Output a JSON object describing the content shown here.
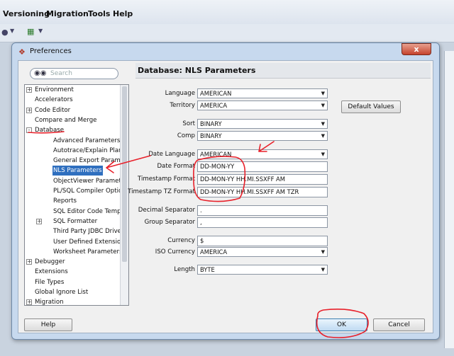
{
  "menubar": {
    "items": [
      "Versioning",
      "Migration",
      "Tools",
      "Help"
    ]
  },
  "dialog": {
    "title": "Preferences",
    "close_glyph": "x",
    "search_placeholder": "Search",
    "panel_title": "Database: NLS Parameters",
    "tree": [
      {
        "label": "Environment",
        "level": 0,
        "expander": "+",
        "selected": false
      },
      {
        "label": "Accelerators",
        "level": 0,
        "expander": "",
        "selected": false
      },
      {
        "label": "Code Editor",
        "level": 0,
        "expander": "+",
        "selected": false
      },
      {
        "label": "Compare and Merge",
        "level": 0,
        "expander": "",
        "selected": false
      },
      {
        "label": "Database",
        "level": 0,
        "expander": "-",
        "selected": false
      },
      {
        "label": "Advanced Parameters",
        "level": 1,
        "expander": "",
        "selected": false
      },
      {
        "label": "Autotrace/Explain Plan",
        "level": 1,
        "expander": "",
        "selected": false
      },
      {
        "label": "General Export Parame",
        "level": 1,
        "expander": "",
        "selected": false
      },
      {
        "label": "NLS Parameters",
        "level": 1,
        "expander": "",
        "selected": true
      },
      {
        "label": "ObjectViewer Paramete",
        "level": 1,
        "expander": "",
        "selected": false
      },
      {
        "label": "PL/SQL Compiler Option",
        "level": 1,
        "expander": "",
        "selected": false
      },
      {
        "label": "Reports",
        "level": 1,
        "expander": "",
        "selected": false
      },
      {
        "label": "SQL Editor Code Templ",
        "level": 1,
        "expander": "",
        "selected": false
      },
      {
        "label": "SQL Formatter",
        "level": 1,
        "expander": "+",
        "selected": false
      },
      {
        "label": "Third Party JDBC Drive",
        "level": 1,
        "expander": "",
        "selected": false
      },
      {
        "label": "User Defined Extension",
        "level": 1,
        "expander": "",
        "selected": false
      },
      {
        "label": "Worksheet Parameters",
        "level": 1,
        "expander": "",
        "selected": false
      },
      {
        "label": "Debugger",
        "level": 0,
        "expander": "+",
        "selected": false
      },
      {
        "label": "Extensions",
        "level": 0,
        "expander": "",
        "selected": false
      },
      {
        "label": "File Types",
        "level": 0,
        "expander": "",
        "selected": false
      },
      {
        "label": "Global Ignore List",
        "level": 0,
        "expander": "",
        "selected": false
      },
      {
        "label": "Migration",
        "level": 0,
        "expander": "+",
        "selected": false
      }
    ],
    "fields": {
      "language": {
        "label": "Language",
        "value": "AMERICAN"
      },
      "territory": {
        "label": "Territory",
        "value": "AMERICA"
      },
      "sort": {
        "label": "Sort",
        "value": "BINARY"
      },
      "comp": {
        "label": "Comp",
        "value": "BINARY"
      },
      "date_language": {
        "label": "Date Language",
        "value": "AMERICAN"
      },
      "date_format": {
        "label": "Date Format",
        "value": "DD-MON-YY"
      },
      "timestamp_format": {
        "label": "Timestamp Format",
        "value": "DD-MON-YY HH.MI.SSXFF AM"
      },
      "timestamp_tz_format": {
        "label": "Timestamp TZ Format",
        "value": "DD-MON-YY HH.MI.SSXFF AM TZR"
      },
      "decimal_separator": {
        "label": "Decimal Separator",
        "value": "."
      },
      "group_separator": {
        "label": "Group Separator",
        "value": ","
      },
      "currency": {
        "label": "Currency",
        "value": "$"
      },
      "iso_currency": {
        "label": "ISO Currency",
        "value": "AMERICA"
      },
      "length": {
        "label": "Length",
        "value": "BYTE"
      }
    },
    "buttons": {
      "default_values": "Default Values",
      "help": "Help",
      "ok": "OK",
      "cancel": "Cancel"
    },
    "annotation_color": "#e8202a"
  }
}
